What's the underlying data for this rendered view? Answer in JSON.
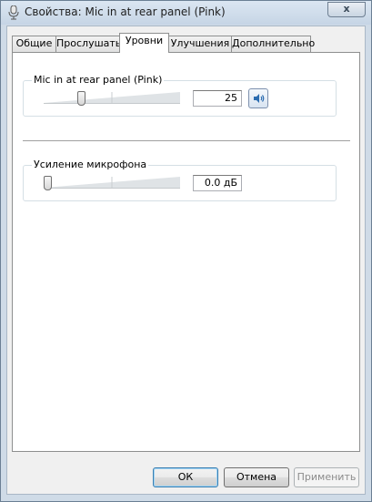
{
  "window": {
    "title": "Свойства: Mic in at rear panel (Pink)",
    "close_label": "x"
  },
  "tabs": [
    {
      "label": "Общие"
    },
    {
      "label": "Прослушать"
    },
    {
      "label": "Уровни",
      "selected": true
    },
    {
      "label": "Улучшения"
    },
    {
      "label": "Дополнительно"
    }
  ],
  "levels": {
    "mic": {
      "label": "Mic in at rear panel (Pink)",
      "value": "25",
      "level": 0.25,
      "mute_icon": "speaker-icon"
    },
    "boost": {
      "label": "Усиление микрофона",
      "value": "0.0 дБ",
      "level": 0
    }
  },
  "footer": {
    "ok_label": "ОК",
    "cancel_label": "Отмена",
    "apply_label": "Применить"
  },
  "colors": {
    "frame": "#cfdbe7",
    "panel": "#ffffff",
    "accent": "#3c7fb1"
  }
}
